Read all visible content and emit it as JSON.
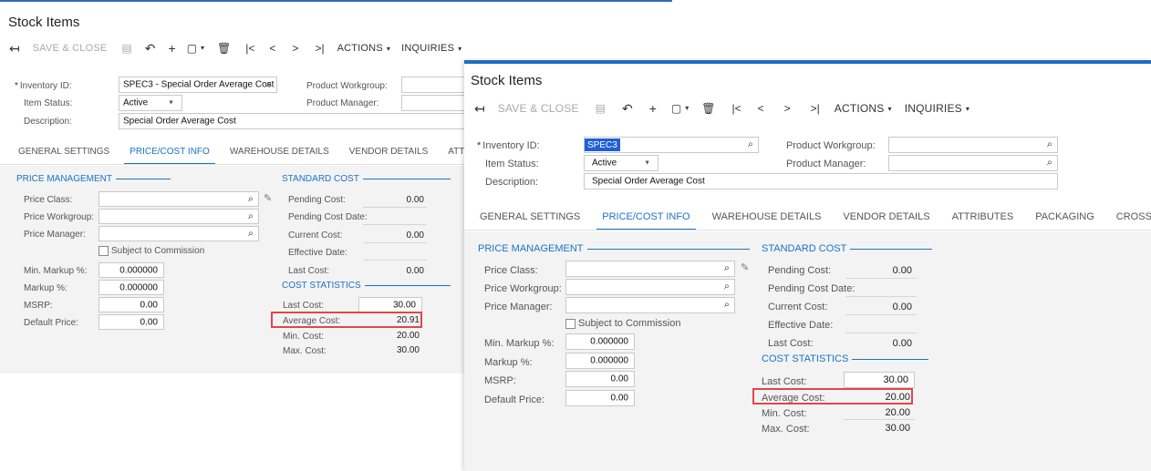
{
  "page_title": "Stock Items",
  "toolbar": {
    "save_close": "SAVE & CLOSE",
    "actions": "ACTIONS",
    "inquiries": "INQUIRIES"
  },
  "header": {
    "inventory_id_label": "Inventory ID:",
    "item_status_label": "Item Status:",
    "description_label": "Description:",
    "product_workgroup_label": "Product Workgroup:",
    "product_manager_label": "Product Manager:",
    "status_value": "Active",
    "description_value": "Special Order Average Cost"
  },
  "back_window": {
    "inventory_id_value": "SPEC3 - Special Order Average Cost"
  },
  "front_window": {
    "inventory_id_value": "SPEC3"
  },
  "tabs": [
    "GENERAL SETTINGS",
    "PRICE/COST INFO",
    "WAREHOUSE DETAILS",
    "VENDOR DETAILS",
    "ATTRIBUTES",
    "PACKAGING",
    "CROSS-REFERENCE"
  ],
  "tabs_back": [
    "GENERAL SETTINGS",
    "PRICE/COST INFO",
    "WAREHOUSE DETAILS",
    "VENDOR DETAILS",
    "ATTRIBUTES"
  ],
  "price_management": {
    "title": "PRICE MANAGEMENT",
    "price_class": "Price Class:",
    "price_workgroup": "Price Workgroup:",
    "price_manager": "Price Manager:",
    "subject_to_commission": "Subject to Commission",
    "min_markup": "Min. Markup %:",
    "markup": "Markup %:",
    "msrp": "MSRP:",
    "default_price": "Default Price:",
    "min_markup_value": "0.000000",
    "markup_value": "0.000000",
    "msrp_value": "0.00",
    "default_price_value": "0.00"
  },
  "standard_cost": {
    "title": "STANDARD COST",
    "pending_cost": "Pending Cost:",
    "pending_cost_date": "Pending Cost Date:",
    "current_cost": "Current Cost:",
    "effective_date": "Effective Date:",
    "last_cost": "Last Cost:",
    "pending_cost_value": "0.00",
    "current_cost_value": "0.00",
    "last_cost_value": "0.00"
  },
  "cost_statistics": {
    "title": "COST STATISTICS",
    "last_cost": "Last Cost:",
    "average_cost": "Average Cost:",
    "min_cost": "Min. Cost:",
    "max_cost": "Max. Cost:",
    "last_cost_value": "30.00",
    "min_cost_value": "20.00",
    "max_cost_value": "30.00"
  },
  "back_values": {
    "average_cost": "20.91"
  },
  "front_values": {
    "average_cost": "20.00"
  },
  "colors": {
    "accent": "#1a73c7",
    "highlight": "#e0474a",
    "selection": "#1f5fd8"
  }
}
